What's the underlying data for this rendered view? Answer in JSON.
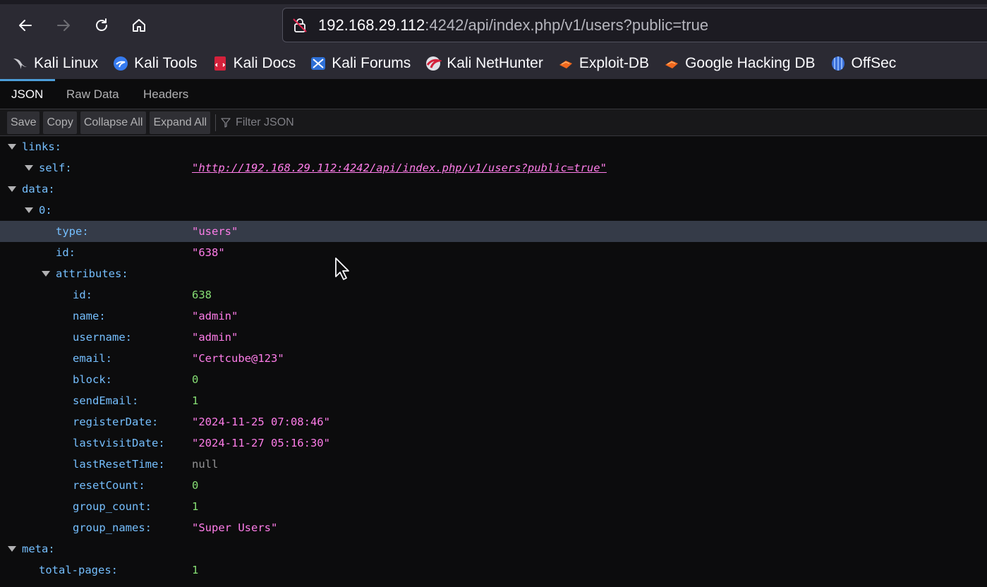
{
  "browser": {
    "url_host": "192.168.29.112",
    "url_rest": ":4242/api/index.php/v1/users?public=true",
    "icons": [
      "back-arrow-icon",
      "forward-arrow-icon",
      "reload-icon",
      "home-icon",
      "insecure-lock-icon"
    ]
  },
  "bookmarks": [
    {
      "label": "Kali Linux",
      "icon": "kali-dragon-icon"
    },
    {
      "label": "Kali Tools",
      "icon": "kali-tools-icon"
    },
    {
      "label": "Kali Docs",
      "icon": "kali-docs-icon"
    },
    {
      "label": "Kali Forums",
      "icon": "kali-forums-icon"
    },
    {
      "label": "Kali NetHunter",
      "icon": "kali-nethunter-icon"
    },
    {
      "label": "Exploit-DB",
      "icon": "exploit-db-icon"
    },
    {
      "label": "Google Hacking DB",
      "icon": "ghdb-icon"
    },
    {
      "label": "OffSec",
      "icon": "offsec-icon"
    }
  ],
  "viewer": {
    "tabs": [
      "JSON",
      "Raw Data",
      "Headers"
    ],
    "selected_tab": "JSON",
    "toolbar": {
      "save": "Save",
      "copy": "Copy",
      "collapse_all": "Collapse All",
      "expand_all": "Expand All",
      "filter_placeholder": "Filter JSON"
    }
  },
  "json_tree": {
    "links_key": "links:",
    "self_key": "self:",
    "self_val": "\"http://192.168.29.112:4242/api/index.php/v1/users?public=true\"",
    "data_key": "data:",
    "item0_key": "0:",
    "type_key": "type:",
    "type_val": "\"users\"",
    "id_key": "id:",
    "id_val": "\"638\"",
    "attributes_key": "attributes:",
    "attributes": [
      {
        "key": "id:",
        "value": "638",
        "kind": "num"
      },
      {
        "key": "name:",
        "value": "\"admin\"",
        "kind": "str"
      },
      {
        "key": "username:",
        "value": "\"admin\"",
        "kind": "str"
      },
      {
        "key": "email:",
        "value": "\"Certcube@123\"",
        "kind": "str"
      },
      {
        "key": "block:",
        "value": "0",
        "kind": "num"
      },
      {
        "key": "sendEmail:",
        "value": "1",
        "kind": "num"
      },
      {
        "key": "registerDate:",
        "value": "\"2024-11-25 07:08:46\"",
        "kind": "str"
      },
      {
        "key": "lastvisitDate:",
        "value": "\"2024-11-27 05:16:30\"",
        "kind": "str"
      },
      {
        "key": "lastResetTime:",
        "value": "null",
        "kind": "nul"
      },
      {
        "key": "resetCount:",
        "value": "0",
        "kind": "num"
      },
      {
        "key": "group_count:",
        "value": "1",
        "kind": "num"
      },
      {
        "key": "group_names:",
        "value": "\"Super Users\"",
        "kind": "str"
      }
    ],
    "meta_key": "meta:",
    "total_pages_key": "total-pages:",
    "total_pages_val": "1"
  },
  "colors": {
    "key": "#75bfff",
    "string": "#ff7de9",
    "number": "#86de74",
    "null": "#939395",
    "highlight_row": "#353b48"
  }
}
